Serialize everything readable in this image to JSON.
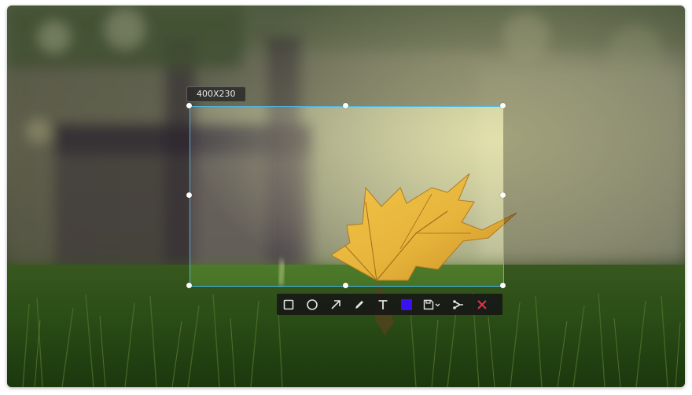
{
  "selection": {
    "size_label": "400X230",
    "border_color": "#49b6e8"
  },
  "toolbar": {
    "tools": [
      {
        "name": "rectangle-icon"
      },
      {
        "name": "ellipse-icon"
      },
      {
        "name": "arrow-icon"
      },
      {
        "name": "pen-icon"
      },
      {
        "name": "text-icon"
      },
      {
        "name": "color-swatch",
        "color": "#3a10f5"
      },
      {
        "name": "save-icon"
      },
      {
        "name": "pin-icon"
      },
      {
        "name": "close-icon",
        "color": "#e8314a"
      }
    ]
  }
}
